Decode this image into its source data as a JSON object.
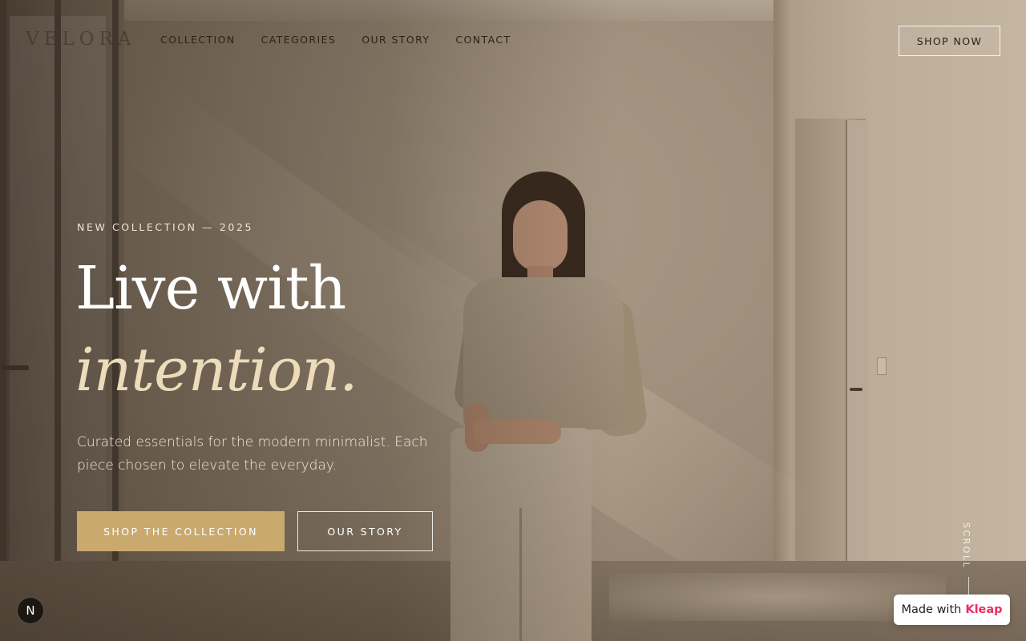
{
  "brand": {
    "logo": "VELORA"
  },
  "nav": {
    "items": [
      "COLLECTION",
      "CATEGORIES",
      "OUR STORY",
      "CONTACT"
    ],
    "cta": "SHOP NOW"
  },
  "hero": {
    "eyebrow": "NEW COLLECTION — 2025",
    "title_line1": "Live with",
    "title_line2": "intention.",
    "subtitle": "Curated essentials for the modern minimalist. Each piece chosen to elevate the everyday.",
    "primary_button": "SHOP THE COLLECTION",
    "secondary_button": "OUR STORY"
  },
  "scroll": {
    "label": "SCROLL"
  },
  "badge": {
    "letter": "N"
  },
  "made_with": {
    "prefix": "Made with",
    "brand": "Kleap"
  },
  "colors": {
    "accent": "#c9a96e",
    "italic_title": "#ecdcb9",
    "kleap_brand": "#ee2c63"
  },
  "icons": {
    "scroll_indicator": "vertical-line-icon"
  }
}
